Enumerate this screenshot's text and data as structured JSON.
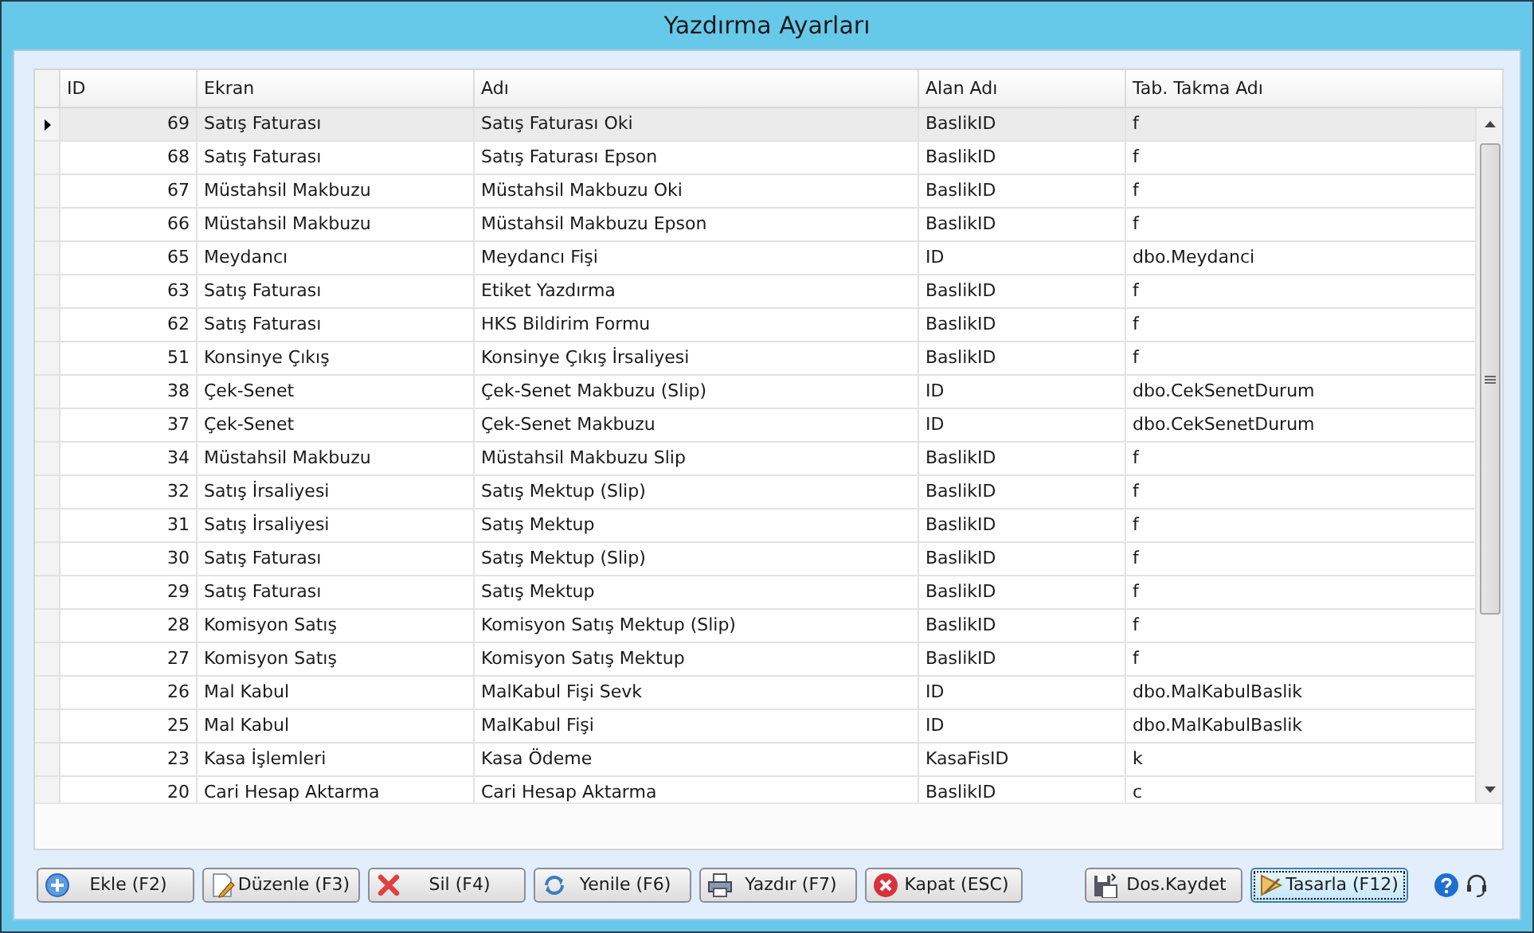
{
  "window": {
    "title": "Yazdırma Ayarları"
  },
  "table": {
    "columns": [
      "ID",
      "Ekran",
      "Adı",
      "Alan Adı",
      "Tab. Takma Adı"
    ],
    "rows": [
      {
        "cells": [
          "69",
          "Satış Faturası",
          "Satış Faturası Oki",
          "BaslikID",
          "f"
        ],
        "selected": true
      },
      {
        "cells": [
          "68",
          "Satış Faturası",
          "Satış Faturası Epson",
          "BaslikID",
          "f"
        ],
        "selected": false
      },
      {
        "cells": [
          "67",
          "Müstahsil Makbuzu",
          "Müstahsil Makbuzu Oki",
          "BaslikID",
          "f"
        ],
        "selected": false
      },
      {
        "cells": [
          "66",
          "Müstahsil Makbuzu",
          "Müstahsil Makbuzu Epson",
          "BaslikID",
          "f"
        ],
        "selected": false
      },
      {
        "cells": [
          "65",
          "Meydancı",
          "Meydancı Fişi",
          "ID",
          "dbo.Meydanci"
        ],
        "selected": false
      },
      {
        "cells": [
          "63",
          "Satış Faturası",
          "Etiket Yazdırma",
          "BaslikID",
          "f"
        ],
        "selected": false
      },
      {
        "cells": [
          "62",
          "Satış Faturası",
          "HKS Bildirim Formu",
          "BaslikID",
          "f"
        ],
        "selected": false
      },
      {
        "cells": [
          "51",
          "Konsinye Çıkış",
          "Konsinye Çıkış İrsaliyesi",
          "BaslikID",
          "f"
        ],
        "selected": false
      },
      {
        "cells": [
          "38",
          "Çek-Senet",
          "Çek-Senet Makbuzu (Slip)",
          "ID",
          "dbo.CekSenetDurum"
        ],
        "selected": false
      },
      {
        "cells": [
          "37",
          "Çek-Senet",
          "Çek-Senet Makbuzu",
          "ID",
          "dbo.CekSenetDurum"
        ],
        "selected": false
      },
      {
        "cells": [
          "34",
          "Müstahsil Makbuzu",
          "Müstahsil Makbuzu Slip",
          "BaslikID",
          "f"
        ],
        "selected": false
      },
      {
        "cells": [
          "32",
          "Satış İrsaliyesi",
          "Satış Mektup (Slip)",
          "BaslikID",
          "f"
        ],
        "selected": false
      },
      {
        "cells": [
          "31",
          "Satış İrsaliyesi",
          "Satış Mektup",
          "BaslikID",
          "f"
        ],
        "selected": false
      },
      {
        "cells": [
          "30",
          "Satış Faturası",
          "Satış Mektup (Slip)",
          "BaslikID",
          "f"
        ],
        "selected": false
      },
      {
        "cells": [
          "29",
          "Satış Faturası",
          "Satış Mektup",
          "BaslikID",
          "f"
        ],
        "selected": false
      },
      {
        "cells": [
          "28",
          "Komisyon Satış",
          "Komisyon Satış Mektup (Slip)",
          "BaslikID",
          "f"
        ],
        "selected": false
      },
      {
        "cells": [
          "27",
          "Komisyon Satış",
          "Komisyon Satış Mektup",
          "BaslikID",
          "f"
        ],
        "selected": false
      },
      {
        "cells": [
          "26",
          "Mal Kabul",
          "MalKabul Fişi Sevk",
          "ID",
          "dbo.MalKabulBaslik"
        ],
        "selected": false
      },
      {
        "cells": [
          "25",
          "Mal Kabul",
          "MalKabul Fişi",
          "ID",
          "dbo.MalKabulBaslik"
        ],
        "selected": false
      },
      {
        "cells": [
          "23",
          "Kasa İşlemleri",
          "Kasa Ödeme",
          "KasaFisID",
          "k"
        ],
        "selected": false
      },
      {
        "cells": [
          "20",
          "Cari Hesap Aktarma",
          "Cari Hesap Aktarma",
          "BaslikID",
          "c"
        ],
        "selected": false
      }
    ]
  },
  "buttons_left": [
    {
      "label": "Ekle (F2)",
      "kind": "add"
    },
    {
      "label": "Düzenle (F3)",
      "kind": "edit"
    },
    {
      "label": "Sil (F4)",
      "kind": "delete"
    },
    {
      "label": "Yenile (F6)",
      "kind": "refresh"
    },
    {
      "label": "Yazdır (F7)",
      "kind": "print"
    },
    {
      "label": "Kapat (ESC)",
      "kind": "close"
    }
  ],
  "buttons_right": [
    {
      "label": "Dos.Kaydet",
      "kind": "save",
      "focused": false
    },
    {
      "label": "Tasarla (F12)",
      "kind": "design",
      "focused": true
    }
  ]
}
